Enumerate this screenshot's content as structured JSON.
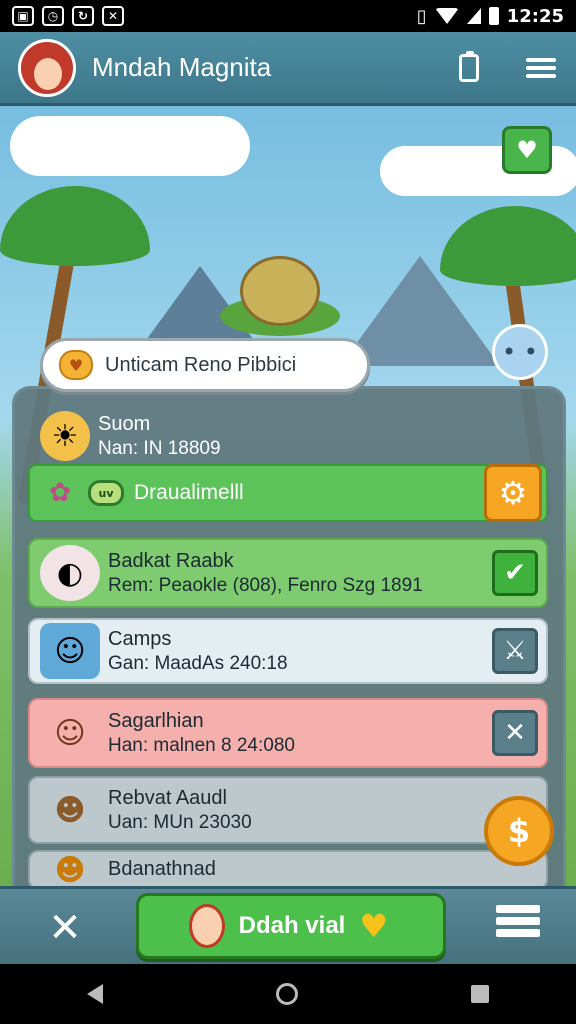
{
  "status_bar": {
    "time": "12:25"
  },
  "header": {
    "title": "Mndah Magnita"
  },
  "banner": {
    "text": "Unticam Reno Pibbici"
  },
  "player": {
    "name": "Suom",
    "code": "Nan: IN 18809"
  },
  "green_bar": {
    "tag": "uv",
    "label": "Draualimelll"
  },
  "rows": [
    {
      "title": "Badkat Raabk",
      "sub": "Rem: Peaokle (808), Fenro Szg 1891",
      "bg": "#7fcb70",
      "action": "check"
    },
    {
      "title": "Camps",
      "sub": "Gan: MaadAs 240:18",
      "bg": "#e4eef2",
      "action": "cross"
    },
    {
      "title": "Sagarlhian",
      "sub": "Han: malnen 8 24:080",
      "bg": "#f5b0ae",
      "action": "cross"
    },
    {
      "title": "Rebvat Aaudl",
      "sub": "Uan: MUn 23030",
      "bg": "#bcc8cc",
      "action": "none"
    },
    {
      "title": "Bdanathnad",
      "sub": "",
      "bg": "#bcc8cc",
      "action": "none"
    }
  ],
  "bottom_bar": {
    "main_label": "Ddah vial"
  },
  "colors": {
    "accent_green": "#4cc04a",
    "accent_orange": "#f6a623",
    "header": "#4f8fa4"
  }
}
